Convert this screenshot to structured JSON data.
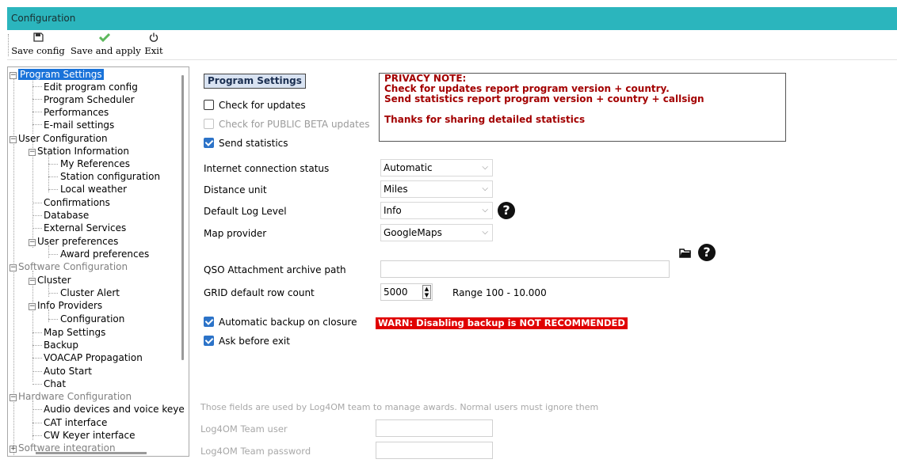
{
  "window": {
    "title": "Configuration"
  },
  "toolbar": {
    "save_config": {
      "label": "Save config",
      "icon": "save-icon"
    },
    "save_apply": {
      "label": "Save and apply",
      "icon": "checkmark-icon",
      "color": "#4caf50"
    },
    "exit": {
      "label": "Exit",
      "icon": "power-icon"
    }
  },
  "tree": {
    "items": [
      {
        "label": "Program Settings"
      },
      {
        "label": "Edit program config"
      },
      {
        "label": "Program Scheduler"
      },
      {
        "label": "Performances"
      },
      {
        "label": "E-mail settings"
      },
      {
        "label": "User Configuration"
      },
      {
        "label": "Station Information"
      },
      {
        "label": "My References"
      },
      {
        "label": "Station configuration"
      },
      {
        "label": "Local weather"
      },
      {
        "label": "Confirmations"
      },
      {
        "label": "Database"
      },
      {
        "label": "External Services"
      },
      {
        "label": "User preferences"
      },
      {
        "label": "Award preferences"
      },
      {
        "label": "Software Configuration"
      },
      {
        "label": "Cluster"
      },
      {
        "label": "Cluster Alert"
      },
      {
        "label": "Info Providers"
      },
      {
        "label": "Configuration"
      },
      {
        "label": "Map Settings"
      },
      {
        "label": "Backup"
      },
      {
        "label": "VOACAP Propagation"
      },
      {
        "label": "Auto Start"
      },
      {
        "label": "Chat"
      },
      {
        "label": "Hardware Configuration"
      },
      {
        "label": "Audio devices and voice keye"
      },
      {
        "label": "CAT interface"
      },
      {
        "label": "CW Keyer interface"
      },
      {
        "label": "Software integration"
      }
    ]
  },
  "main": {
    "section_title": "Program Settings",
    "privacy_note": {
      "line1": "PRIVACY NOTE:",
      "line2": "Check for updates report program version + country.",
      "line3": "Send statistics report program version + country + callsign",
      "line4": "Thanks for sharing detailed statistics"
    },
    "check_updates": {
      "label": "Check for updates",
      "checked": false
    },
    "check_beta": {
      "label": "Check for PUBLIC BETA updates",
      "checked": false
    },
    "send_statistics": {
      "label": "Send statistics",
      "checked": true
    },
    "internet_status": {
      "label": "Internet connection status",
      "value": "Automatic"
    },
    "distance_unit": {
      "label": "Distance unit",
      "value": "Miles"
    },
    "log_level": {
      "label": "Default Log Level",
      "value": "Info"
    },
    "map_provider": {
      "label": "Map provider",
      "value": "GoogleMaps"
    },
    "qso_archive": {
      "label": "QSO Attachment archive path",
      "value": ""
    },
    "grid_rows": {
      "label": "GRID default row count",
      "value": "5000",
      "range": "Range 100 - 10.000"
    },
    "auto_backup": {
      "label": "Automatic backup on closure",
      "checked": true
    },
    "backup_warning": "WARN: Disabling backup is NOT RECOMMENDED",
    "ask_exit": {
      "label": "Ask before exit",
      "checked": true
    },
    "team_note": "Those fields are used by Log4OM team to manage awards. Normal users must ignore them",
    "team_user": {
      "label": "Log4OM Team user",
      "value": ""
    },
    "team_password": {
      "label": "Log4OM Team password",
      "value": ""
    },
    "help_icon": "?"
  },
  "colors": {
    "titlebar": "#2bb5bd",
    "selection": "#1a73d9",
    "privacy_text": "#a30000",
    "warning_bg": "#e00000",
    "checkbox": "#2c73c8"
  }
}
